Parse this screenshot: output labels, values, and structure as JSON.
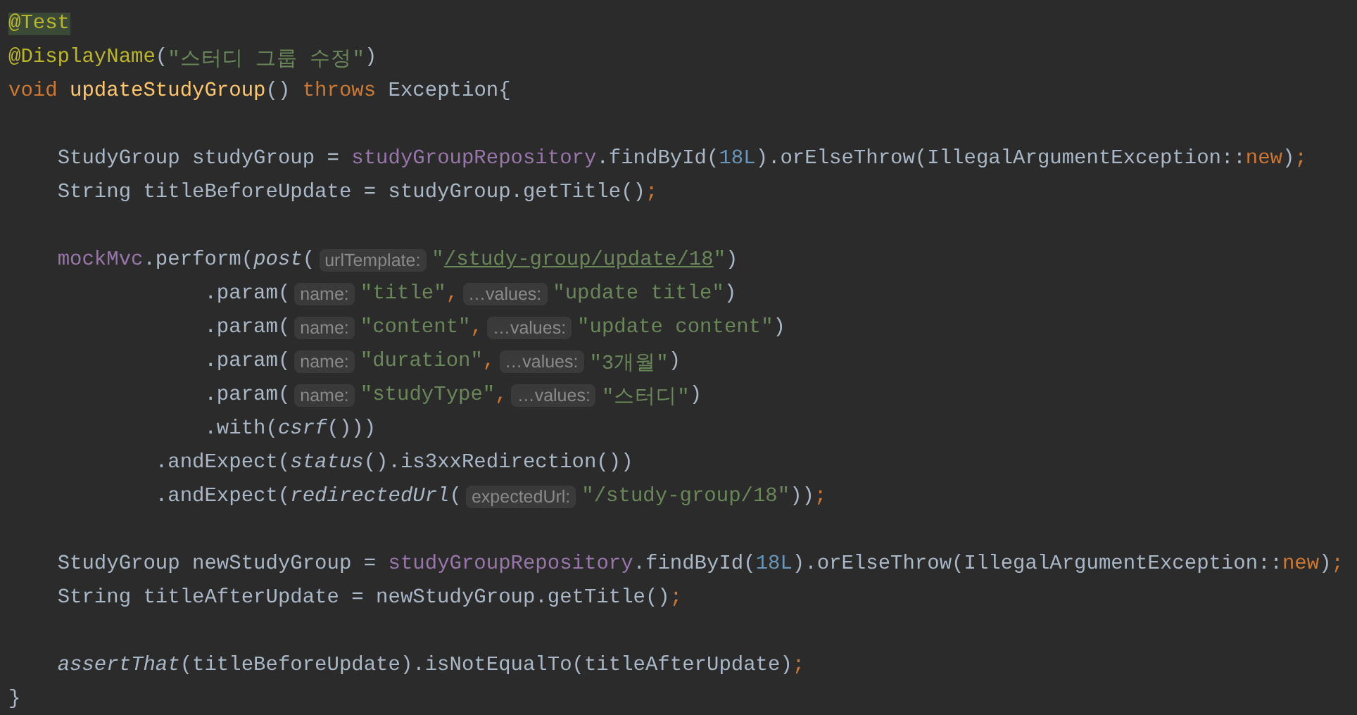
{
  "editor": {
    "lines": [
      {
        "kind": "code",
        "tokens": [
          {
            "kind": "annotation-match",
            "text": "@Test"
          }
        ]
      },
      {
        "kind": "code",
        "tokens": [
          {
            "kind": "annotation",
            "text": "@DisplayName"
          },
          {
            "kind": "plain",
            "text": "("
          },
          {
            "kind": "string",
            "text": "\"스터디 그룹 수정\""
          },
          {
            "kind": "plain",
            "text": ")"
          }
        ]
      },
      {
        "kind": "code",
        "tokens": [
          {
            "kind": "keyword",
            "text": "void "
          },
          {
            "kind": "method",
            "text": "updateStudyGroup"
          },
          {
            "kind": "plain",
            "text": "() "
          },
          {
            "kind": "keyword",
            "text": "throws "
          },
          {
            "kind": "plain",
            "text": "Exception{"
          }
        ]
      },
      {
        "kind": "blank"
      },
      {
        "kind": "code",
        "tokens": [
          {
            "kind": "plain",
            "text": "    StudyGroup studyGroup = "
          },
          {
            "kind": "field",
            "text": "studyGroupRepository"
          },
          {
            "kind": "plain",
            "text": ".findById("
          },
          {
            "kind": "number",
            "text": "18L"
          },
          {
            "kind": "plain",
            "text": ").orElseThrow(IllegalArgumentException::"
          },
          {
            "kind": "keyword",
            "text": "new"
          },
          {
            "kind": "plain",
            "text": ")"
          },
          {
            "kind": "keyword",
            "text": ";"
          }
        ]
      },
      {
        "kind": "code",
        "tokens": [
          {
            "kind": "plain",
            "text": "    String titleBeforeUpdate = studyGroup.getTitle()"
          },
          {
            "kind": "keyword",
            "text": ";"
          }
        ]
      },
      {
        "kind": "blank"
      },
      {
        "kind": "code",
        "tokens": [
          {
            "kind": "field",
            "text": "    mockMvc"
          },
          {
            "kind": "plain",
            "text": ".perform("
          },
          {
            "kind": "italic",
            "text": "post"
          },
          {
            "kind": "plain",
            "text": "("
          },
          {
            "kind": "hint",
            "text": "urlTemplate:"
          },
          {
            "kind": "string",
            "text": "\""
          },
          {
            "kind": "url",
            "text": "/study-group/update/18"
          },
          {
            "kind": "string",
            "text": "\""
          },
          {
            "kind": "plain",
            "text": ")"
          }
        ]
      },
      {
        "kind": "code",
        "tokens": [
          {
            "kind": "plain",
            "text": "                .param("
          },
          {
            "kind": "hint",
            "text": "name:"
          },
          {
            "kind": "string",
            "text": "\"title\""
          },
          {
            "kind": "keyword",
            "text": ","
          },
          {
            "kind": "hint",
            "text": "…values:"
          },
          {
            "kind": "string",
            "text": "\"update title\""
          },
          {
            "kind": "plain",
            "text": ")"
          }
        ]
      },
      {
        "kind": "code",
        "tokens": [
          {
            "kind": "plain",
            "text": "                .param("
          },
          {
            "kind": "hint",
            "text": "name:"
          },
          {
            "kind": "string",
            "text": "\"content\""
          },
          {
            "kind": "keyword",
            "text": ","
          },
          {
            "kind": "hint",
            "text": "…values:"
          },
          {
            "kind": "string",
            "text": "\"update content\""
          },
          {
            "kind": "plain",
            "text": ")"
          }
        ]
      },
      {
        "kind": "code",
        "tokens": [
          {
            "kind": "plain",
            "text": "                .param("
          },
          {
            "kind": "hint",
            "text": "name:"
          },
          {
            "kind": "string",
            "text": "\"duration\""
          },
          {
            "kind": "keyword",
            "text": ","
          },
          {
            "kind": "hint",
            "text": "…values:"
          },
          {
            "kind": "string",
            "text": "\"3개월\""
          },
          {
            "kind": "plain",
            "text": ")"
          }
        ]
      },
      {
        "kind": "code",
        "tokens": [
          {
            "kind": "plain",
            "text": "                .param("
          },
          {
            "kind": "hint",
            "text": "name:"
          },
          {
            "kind": "string",
            "text": "\"studyType\""
          },
          {
            "kind": "keyword",
            "text": ","
          },
          {
            "kind": "hint",
            "text": "…values:"
          },
          {
            "kind": "string",
            "text": "\"스터디\""
          },
          {
            "kind": "plain",
            "text": ")"
          }
        ]
      },
      {
        "kind": "code",
        "tokens": [
          {
            "kind": "plain",
            "text": "                .with("
          },
          {
            "kind": "italic",
            "text": "csrf"
          },
          {
            "kind": "plain",
            "text": "()))"
          }
        ]
      },
      {
        "kind": "code",
        "tokens": [
          {
            "kind": "plain",
            "text": "            .andExpect("
          },
          {
            "kind": "italic",
            "text": "status"
          },
          {
            "kind": "plain",
            "text": "().is3xxRedirection())"
          }
        ]
      },
      {
        "kind": "code",
        "tokens": [
          {
            "kind": "plain",
            "text": "            .andExpect("
          },
          {
            "kind": "italic",
            "text": "redirectedUrl"
          },
          {
            "kind": "plain",
            "text": "("
          },
          {
            "kind": "hint",
            "text": "expectedUrl:"
          },
          {
            "kind": "string",
            "text": "\"/study-group/18\""
          },
          {
            "kind": "plain",
            "text": "))"
          },
          {
            "kind": "keyword",
            "text": ";"
          }
        ]
      },
      {
        "kind": "blank"
      },
      {
        "kind": "code",
        "tokens": [
          {
            "kind": "plain",
            "text": "    StudyGroup newStudyGroup = "
          },
          {
            "kind": "field",
            "text": "studyGroupRepository"
          },
          {
            "kind": "plain",
            "text": ".findById("
          },
          {
            "kind": "number",
            "text": "18L"
          },
          {
            "kind": "plain",
            "text": ").orElseThrow(IllegalArgumentException::"
          },
          {
            "kind": "keyword",
            "text": "new"
          },
          {
            "kind": "plain",
            "text": ")"
          },
          {
            "kind": "keyword",
            "text": ";"
          }
        ]
      },
      {
        "kind": "code",
        "tokens": [
          {
            "kind": "plain",
            "text": "    String titleAfterUpdate = newStudyGroup.getTitle()"
          },
          {
            "kind": "keyword",
            "text": ";"
          }
        ]
      },
      {
        "kind": "blank"
      },
      {
        "kind": "code",
        "tokens": [
          {
            "kind": "italic",
            "text": "    assertThat"
          },
          {
            "kind": "plain",
            "text": "(titleBeforeUpdate).isNotEqualTo(titleAfterUpdate)"
          },
          {
            "kind": "keyword",
            "text": ";"
          }
        ]
      },
      {
        "kind": "code",
        "tokens": [
          {
            "kind": "plain",
            "text": "}"
          }
        ]
      }
    ]
  }
}
